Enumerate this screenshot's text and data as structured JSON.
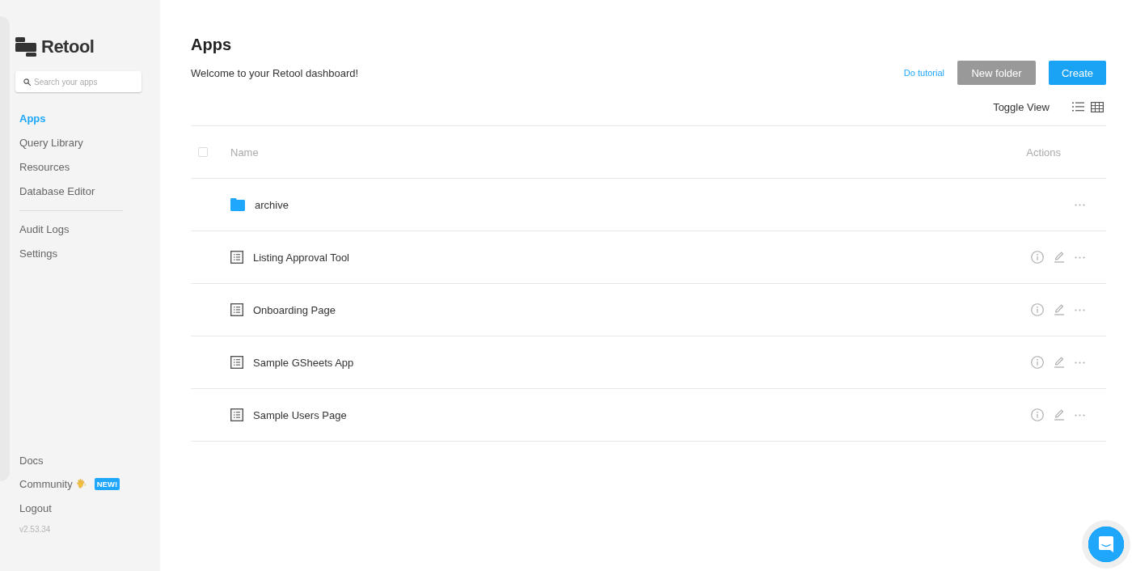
{
  "sidebar": {
    "logo_text": "Retool",
    "search": {
      "placeholder": "Search your apps"
    },
    "nav": [
      {
        "label": "Apps",
        "selected": true
      },
      {
        "label": "Query Library",
        "selected": false
      },
      {
        "label": "Resources",
        "selected": false
      },
      {
        "label": "Database Editor",
        "selected": false
      }
    ],
    "nav_secondary": [
      {
        "label": "Audit Logs",
        "selected": false
      },
      {
        "label": "Settings",
        "selected": false
      }
    ],
    "footer": [
      {
        "label": "Docs"
      },
      {
        "label": "Community",
        "badge": "NEW!"
      },
      {
        "label": "Logout"
      }
    ],
    "version": "v2.53.34"
  },
  "header": {
    "title": "Apps",
    "welcome": "Welcome to your Retool dashboard!",
    "tutorial_link": "Do tutorial",
    "buttons": [
      {
        "label": "New folder",
        "kind": "secondary"
      },
      {
        "label": "Create",
        "kind": "primary"
      }
    ],
    "toggle_view": {
      "label": "Toggle View"
    }
  },
  "table": {
    "select_all": {
      "checked": false
    },
    "columns": [
      "Name",
      "Actions"
    ],
    "rows": [
      {
        "kind": "folder",
        "name": "archive"
      },
      {
        "kind": "app",
        "name": "Listing Approval Tool"
      },
      {
        "kind": "app",
        "name": "Onboarding Page"
      },
      {
        "kind": "app",
        "name": "Sample GSheets App"
      },
      {
        "kind": "app",
        "name": "Sample Users Page"
      }
    ]
  }
}
